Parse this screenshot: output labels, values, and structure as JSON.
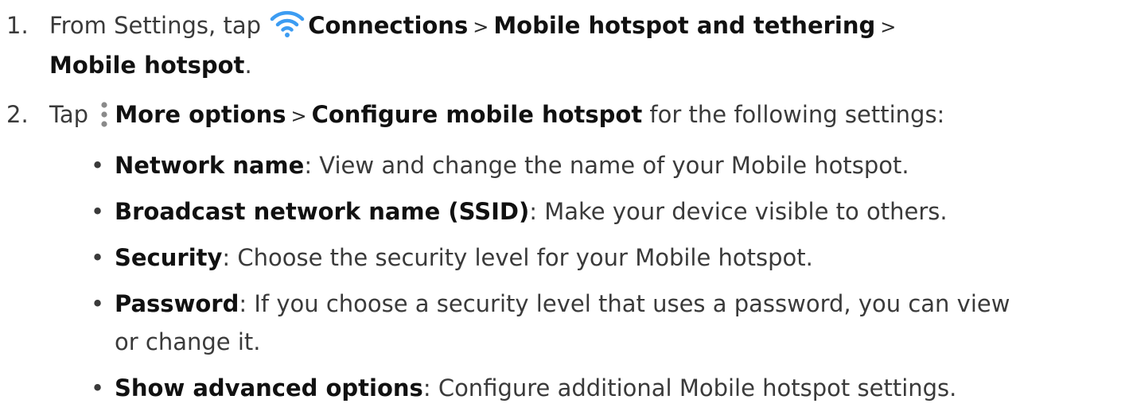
{
  "steps": [
    {
      "number": "1.",
      "prefix": "From Settings, tap ",
      "path1": "Connections",
      "sep1": ">",
      "path2": "Mobile hotspot and tethering",
      "sep2": ">",
      "path3": "Mobile hotspot",
      "suffix": "."
    },
    {
      "number": "2.",
      "prefix": "Tap ",
      "path1": "More options",
      "sep1": ">",
      "path2": "Configure mobile hotspot",
      "suffix": " for the following settings:"
    }
  ],
  "bullets": [
    {
      "term": "Network name",
      "desc": ": View and change the name of your Mobile hotspot."
    },
    {
      "term": "Broadcast network name (SSID)",
      "desc": ": Make your device visible to others."
    },
    {
      "term": "Security",
      "desc": ": Choose the security level for your Mobile hotspot."
    },
    {
      "term": "Password",
      "desc": ": If you choose a security level that uses a password, you can view or change it."
    },
    {
      "term": "Show advanced options",
      "desc": ": Configure additional Mobile hotspot settings."
    }
  ],
  "bullet_symbol": "•",
  "icons": {
    "connections": "wifi-icon",
    "more_options": "more-options-icon"
  },
  "colors": {
    "wifi_icon": "#3c9cf2",
    "dots_icon": "#8a8a8a"
  }
}
